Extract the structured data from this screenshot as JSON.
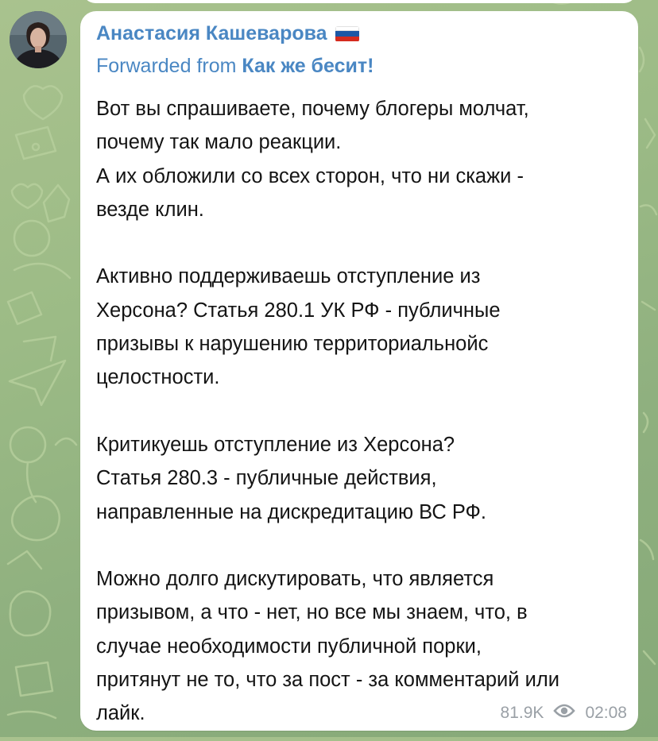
{
  "channel_author": {
    "name": "Анастасия Кашеварова",
    "flag_icon": "russia-flag-icon",
    "flag_colors": [
      "#ffffff",
      "#1c57a5",
      "#d52b1e"
    ]
  },
  "forward": {
    "prefix": "Forwarded from ",
    "source": "Как же бесит!"
  },
  "message": {
    "paragraphs": [
      "Вот вы спрашиваете, почему блогеры молчат,\nпочему так мало реакции.\nА их обложили со всех сторон, что ни скажи -\nвезде клин.",
      "Активно поддерживаешь отступление из\nХерсона? Статья 280.1 УК РФ - публичные\nпризывы к нарушению территориальнойс\nцелостности.",
      "Критикуешь отступление из Херсона?\nСтатья 280.3 - публичные действия,\nнаправленные на дискредитацию ВС РФ.",
      "Можно долго дискутировать, что является\nпризывом, а что - нет, но все мы знаем, что, в\nслучае необходимости публичной порки,\nпритянут не то, что за пост - за комментарий или\nлайк."
    ],
    "views": "81.9K",
    "views_icon": "eye-icon",
    "time": "02:08"
  },
  "colors": {
    "accent": "#4a87c3",
    "text": "#141414",
    "meta": "#9aa0a6",
    "bubble": "#ffffff",
    "wallpaper": "#9cbb86"
  }
}
